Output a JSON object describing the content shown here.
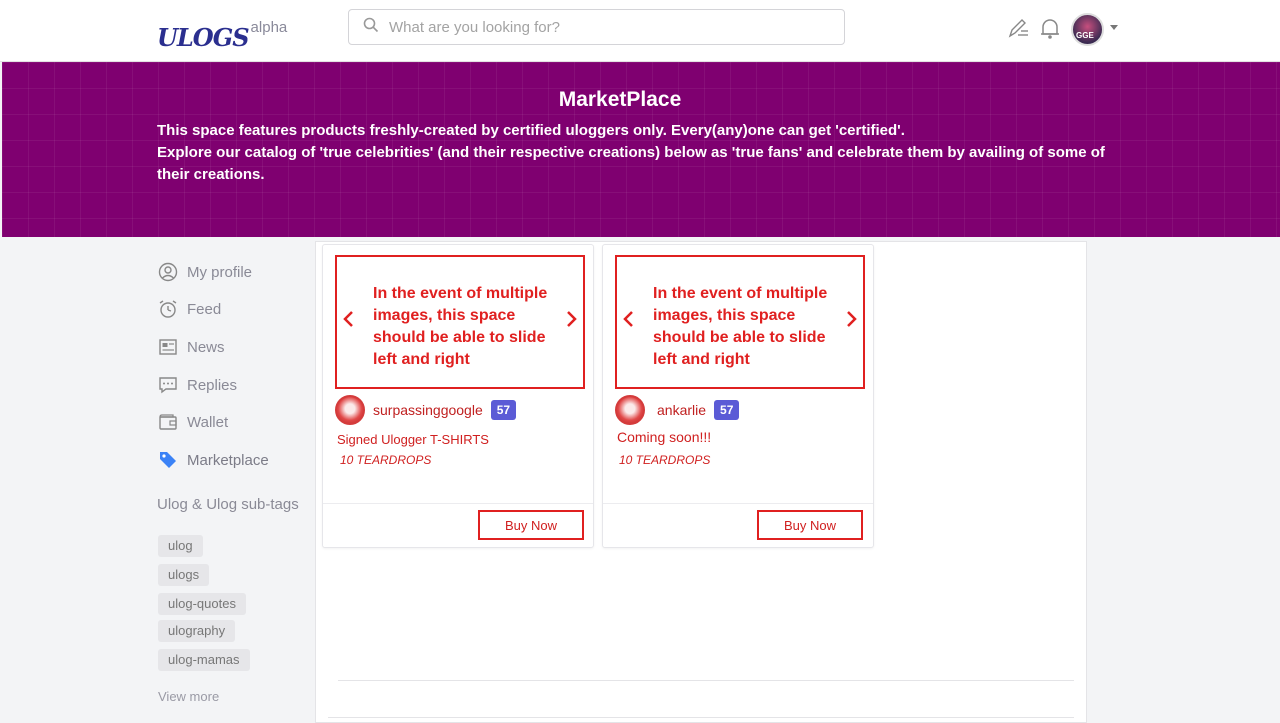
{
  "header": {
    "logo_text": "ULOGS",
    "logo_badge": "alpha",
    "search_placeholder": "What are you looking for?",
    "avatar_text": "GGE"
  },
  "banner": {
    "title": "MarketPlace",
    "line1": "This space features products freshly-created by certified uloggers only. Every(any)one can get 'certified'.",
    "line2": "Explore our catalog of 'true celebrities' (and their respective creations) below as 'true fans' and celebrate them by availing of some of their creations."
  },
  "sidebar": {
    "items": [
      {
        "label": "My profile",
        "icon": "user-circle-icon"
      },
      {
        "label": "Feed",
        "icon": "alarm-clock-icon"
      },
      {
        "label": "News",
        "icon": "newspaper-icon"
      },
      {
        "label": "Replies",
        "icon": "chat-icon"
      },
      {
        "label": "Wallet",
        "icon": "wallet-icon"
      },
      {
        "label": "Marketplace",
        "icon": "tag-icon"
      }
    ],
    "section_title": "Ulog & Ulog sub-tags",
    "tags": [
      "ulog",
      "ulogs",
      "ulog-quotes",
      "ulography",
      "ulog-mamas"
    ],
    "view_more": "View more"
  },
  "products": [
    {
      "image_note": "In the event of multiple images, this space should be able to slide left and right",
      "seller": "surpassinggoogle",
      "reputation": "57",
      "title": "Signed Ulogger T-SHIRTS",
      "price": "10 TEARDROPS",
      "buy_label": "Buy Now"
    },
    {
      "image_note": "In the event of multiple images, this space should be able to slide left and right",
      "seller": "ankarlie",
      "reputation": "57",
      "title": "Coming soon!!!",
      "price": "10 TEARDROPS",
      "buy_label": "Buy Now"
    }
  ],
  "colors": {
    "banner": "#7f0070",
    "annotation_red": "#e02020",
    "reputation_badge": "#5b5bd6",
    "marketplace_tag": "#3b82f6"
  }
}
